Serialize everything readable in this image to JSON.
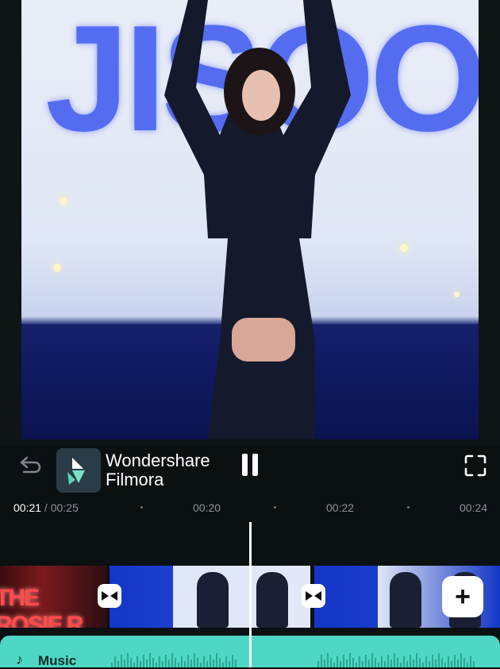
{
  "watermark": {
    "line1": "Wondershare",
    "line2": "Filmora"
  },
  "preview": {
    "overlay_text": "JISOO"
  },
  "ruler": {
    "current_time": "00:21",
    "separator": " / ",
    "total_time": "00:25",
    "ticks": [
      "00:20",
      "00:22",
      "00:24"
    ]
  },
  "clips": {
    "clip1_text": "THE ROSIE R"
  },
  "timeline": {
    "add_label": "+"
  },
  "music": {
    "label": "Music"
  },
  "colors": {
    "accent": "#4ed7c4",
    "background": "#0b1012",
    "clip_blue": "#1d3fd0"
  }
}
